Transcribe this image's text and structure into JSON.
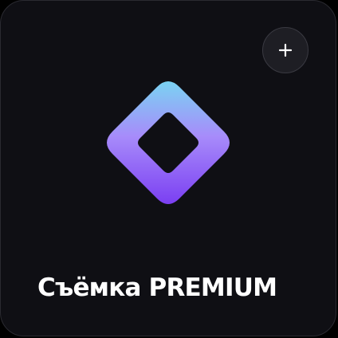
{
  "card": {
    "title": "Съёмка PREMIUM",
    "add_button_icon": "plus-icon",
    "logo_icon": "rounded-diamond-frame-icon",
    "colors": {
      "background": "#0f0f14",
      "border": "#2a2a31",
      "title": "#ffffff",
      "logo_gradient_top": "#7ad3f2",
      "logo_gradient_mid": "#a78bfa",
      "logo_gradient_bottom": "#7b3ff2"
    }
  }
}
